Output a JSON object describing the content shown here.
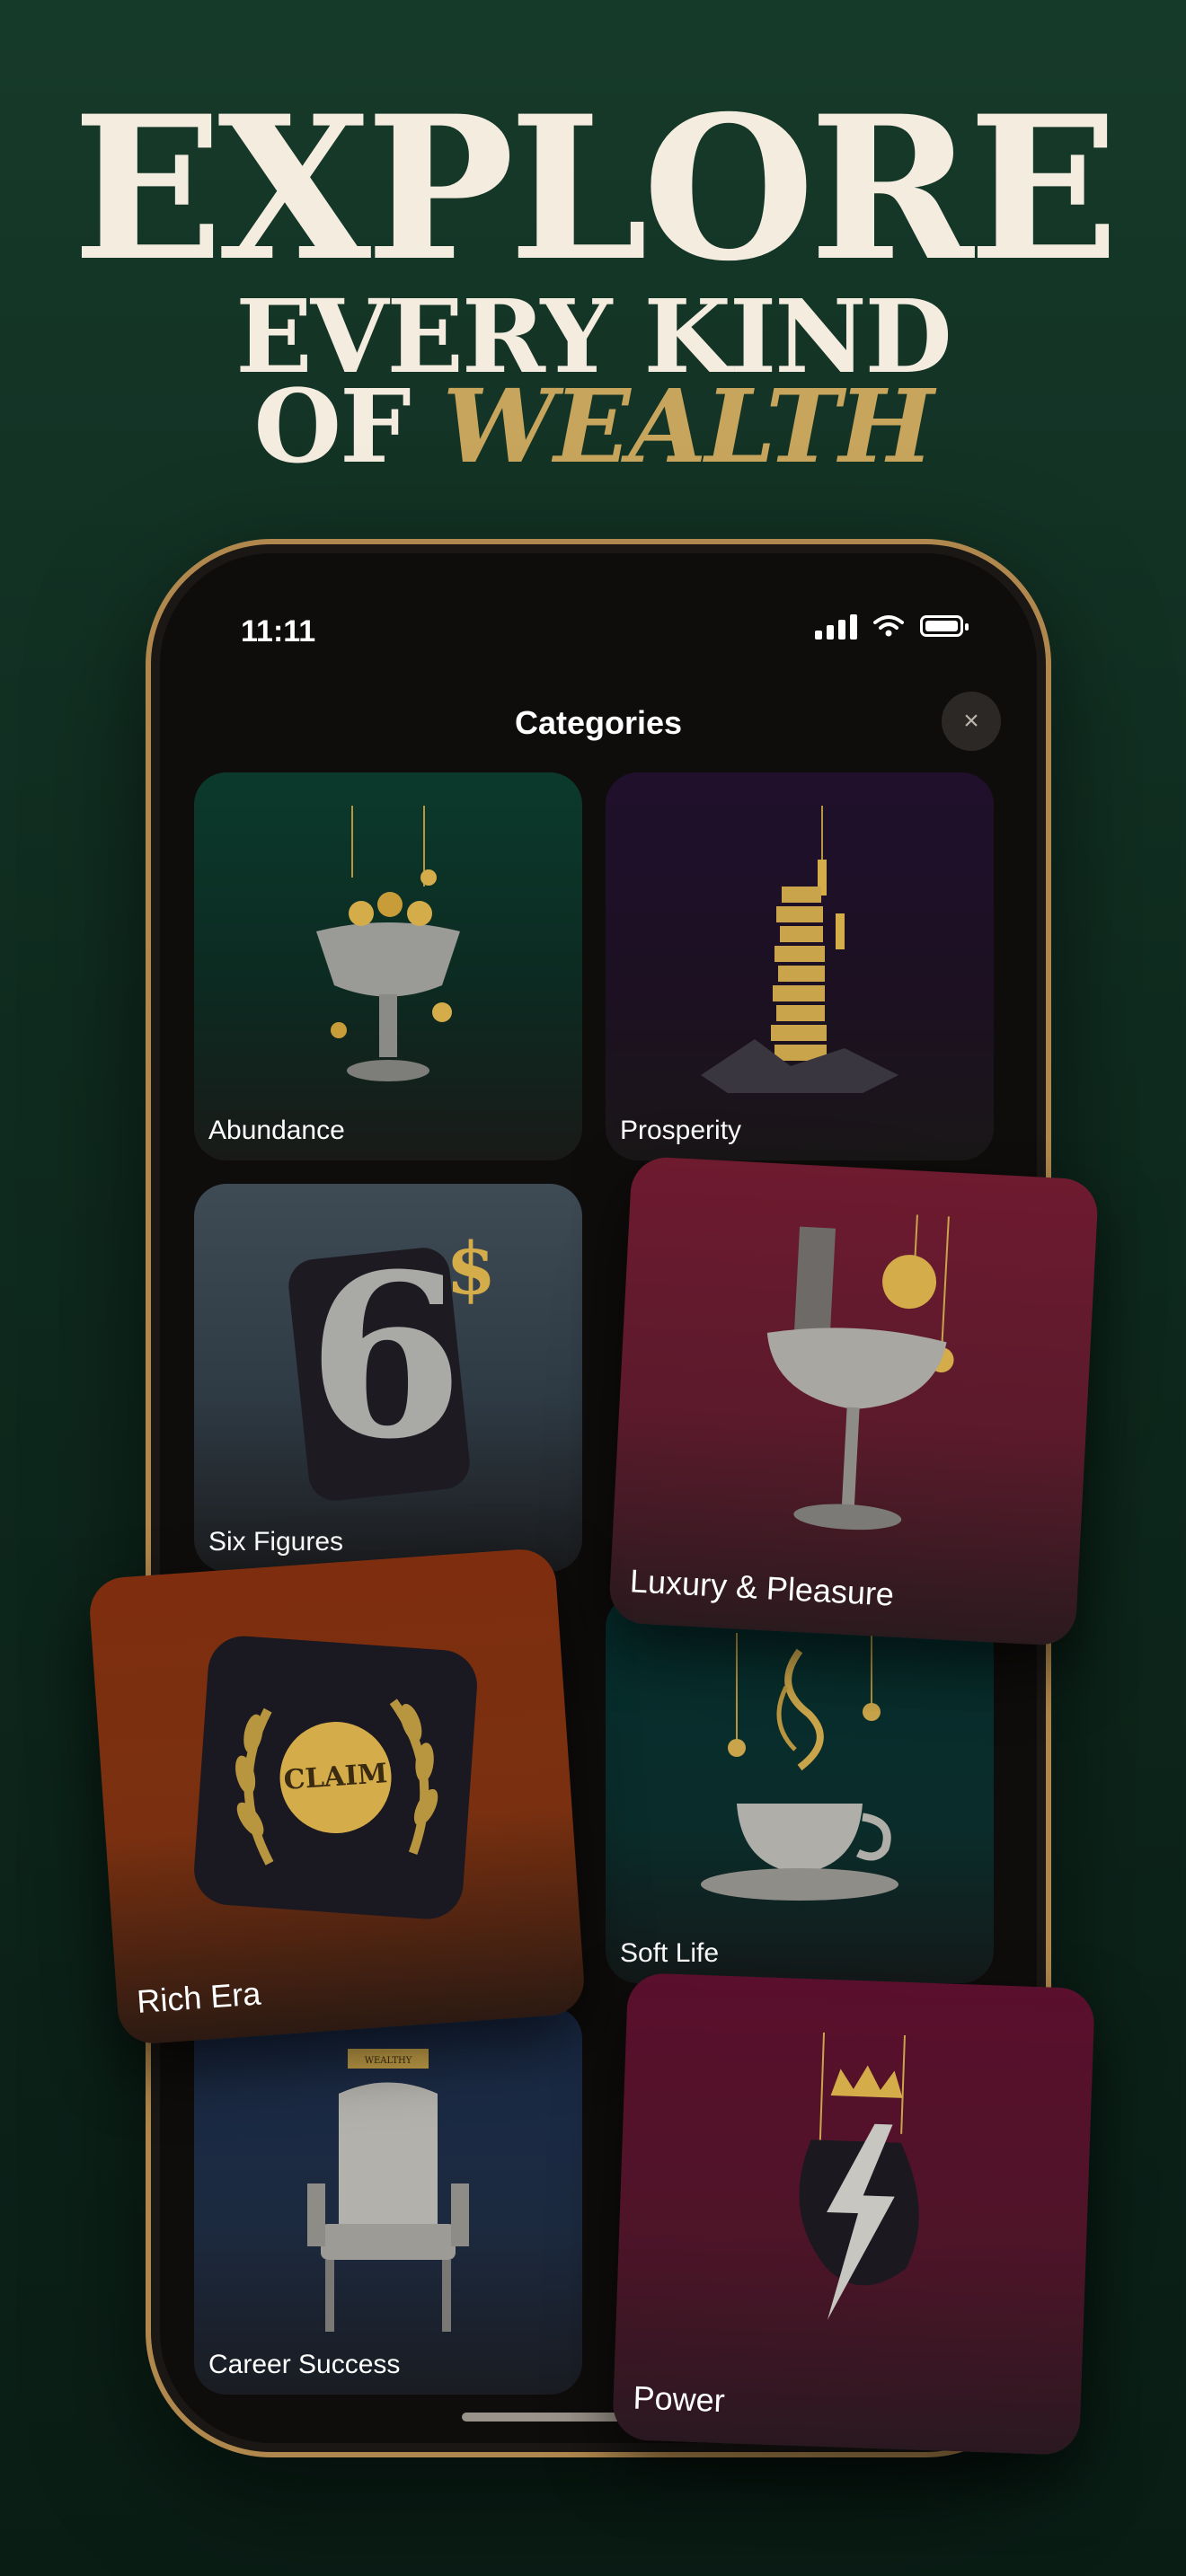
{
  "headline": {
    "line1": "EXPLORE",
    "line2": "EVERY KIND",
    "line3_a": "OF ",
    "line3_b": "WEALTH"
  },
  "status": {
    "time": "11:11"
  },
  "sheet": {
    "title": "Categories",
    "close_icon": "×"
  },
  "categories": [
    {
      "label": "Abundance"
    },
    {
      "label": "Prosperity"
    },
    {
      "label": "Six Figures"
    },
    {
      "label": "Luxury & Pleasure"
    },
    {
      "label": "Rich Era"
    },
    {
      "label": "Soft Life"
    },
    {
      "label": "Career Success"
    },
    {
      "label": "Power"
    }
  ],
  "art_text": {
    "six": "6",
    "dollar": "$",
    "claim": "CLAIM",
    "plaque": "WEALTHY"
  },
  "colors": {
    "gold": "#c8a55c",
    "cream": "#f4ecdf",
    "background": "#163a2a"
  }
}
